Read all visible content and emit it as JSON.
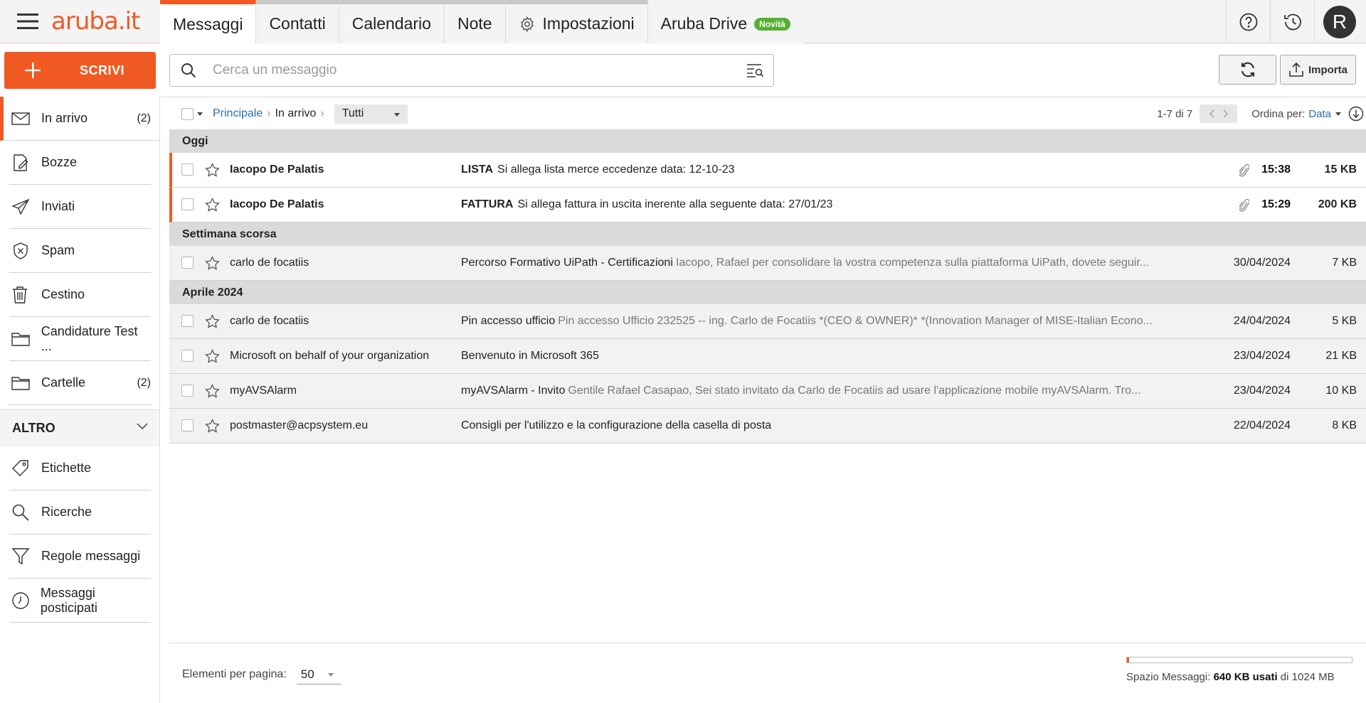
{
  "brand": {
    "logo_text": "aruba.it",
    "accent": "#f05a22"
  },
  "tabs": [
    {
      "label": "Messaggi",
      "active": true
    },
    {
      "label": "Contatti"
    },
    {
      "label": "Calendario"
    },
    {
      "label": "Note"
    },
    {
      "label": "Impostazioni",
      "icon": "gear-icon"
    },
    {
      "label": "Aruba Drive",
      "badge": "Novità"
    }
  ],
  "header": {
    "avatar_initial": "R",
    "help_icon": "help-icon",
    "history_icon": "history-icon"
  },
  "compose": {
    "label": "SCRIVI"
  },
  "sidebar": {
    "folders": [
      {
        "label": "In arrivo",
        "count": "(2)",
        "icon": "inbox-icon"
      },
      {
        "label": "Bozze",
        "count": "",
        "icon": "drafts-icon"
      },
      {
        "label": "Inviati",
        "count": "",
        "icon": "sent-icon"
      },
      {
        "label": "Spam",
        "count": "",
        "icon": "spam-icon"
      },
      {
        "label": "Cestino",
        "count": "",
        "icon": "trash-icon"
      },
      {
        "label": "Candidature Test ...",
        "count": "",
        "icon": "folder-icon"
      },
      {
        "label": "Cartelle",
        "count": "(2)",
        "icon": "folder-icon"
      }
    ],
    "altro_label": "ALTRO",
    "altro_items": [
      {
        "label": "Etichette",
        "icon": "tag-icon"
      },
      {
        "label": "Ricerche",
        "icon": "search-icon"
      },
      {
        "label": "Regole messaggi",
        "icon": "filter-icon"
      },
      {
        "label": "Messaggi posticipati",
        "icon": "clock-icon"
      }
    ]
  },
  "search": {
    "placeholder": "Cerca un messaggio"
  },
  "toolbar": {
    "import_label": "Importa"
  },
  "breadcrumb": {
    "root": "Principale",
    "current": "In arrivo",
    "filter": "Tutti"
  },
  "pager": {
    "range": "1-7 di 7",
    "sort_label": "Ordina per:",
    "sort_value": "Data"
  },
  "groups": [
    {
      "label": "Oggi",
      "messages": [
        {
          "from": "Iacopo De Palatis",
          "tag": "LISTA",
          "subject": "Si allega lista merce eccedenze data: 12-10-23",
          "preview": "",
          "when": "15:38",
          "size": "15 KB",
          "unread": true,
          "attachment": true
        },
        {
          "from": "Iacopo De Palatis",
          "tag": "FATTURA",
          "subject": "Si allega fattura in uscita inerente alla seguente data: 27/01/23",
          "preview": "",
          "when": "15:29",
          "size": "200 KB",
          "unread": true,
          "attachment": true
        }
      ]
    },
    {
      "label": "Settimana scorsa",
      "messages": [
        {
          "from": "carlo de focatiis",
          "tag": "",
          "subject": "Percorso Formativo UiPath - Certificazioni",
          "preview": "Iacopo, Rafael per consolidare la vostra competenza sulla piattaforma UiPath, dovete seguir...",
          "when": "30/04/2024",
          "size": "7 KB",
          "unread": false,
          "attachment": false
        }
      ]
    },
    {
      "label": "Aprile 2024",
      "messages": [
        {
          "from": "carlo de focatiis",
          "tag": "",
          "subject": "Pin accesso ufficio",
          "preview": "Pin accesso Ufficio 232525 -- ing. Carlo de Focatiis *(CEO & OWNER)* *(Innovation Manager of MISE-Italian Econo...",
          "when": "24/04/2024",
          "size": "5 KB",
          "unread": false,
          "attachment": false
        },
        {
          "from": "Microsoft on behalf of your organization",
          "tag": "",
          "subject": "Benvenuto in Microsoft 365",
          "preview": "",
          "when": "23/04/2024",
          "size": "21 KB",
          "unread": false,
          "attachment": false
        },
        {
          "from": "myAVSAlarm",
          "tag": "",
          "subject": "myAVSAlarm - Invito",
          "preview": "Gentile Rafael Casapao,   Sei stato invitato da Carlo de Focatiis ad usare l'applicazione mobile myAVSAlarm.   Tro...",
          "when": "23/04/2024",
          "size": "10 KB",
          "unread": false,
          "attachment": false
        },
        {
          "from": "postmaster@acpsystem.eu",
          "tag": "",
          "subject": "Consigli per l'utilizzo e la configurazione della casella di posta",
          "preview": "",
          "when": "22/04/2024",
          "size": "8 KB",
          "unread": false,
          "attachment": false
        }
      ]
    }
  ],
  "footer": {
    "per_page_label": "Elementi per pagina:",
    "per_page_value": "50",
    "quota_prefix": "Spazio Messaggi:",
    "quota_used": "640 KB usati",
    "quota_suffix": "di 1024 MB",
    "quota_fraction": 0.006
  }
}
